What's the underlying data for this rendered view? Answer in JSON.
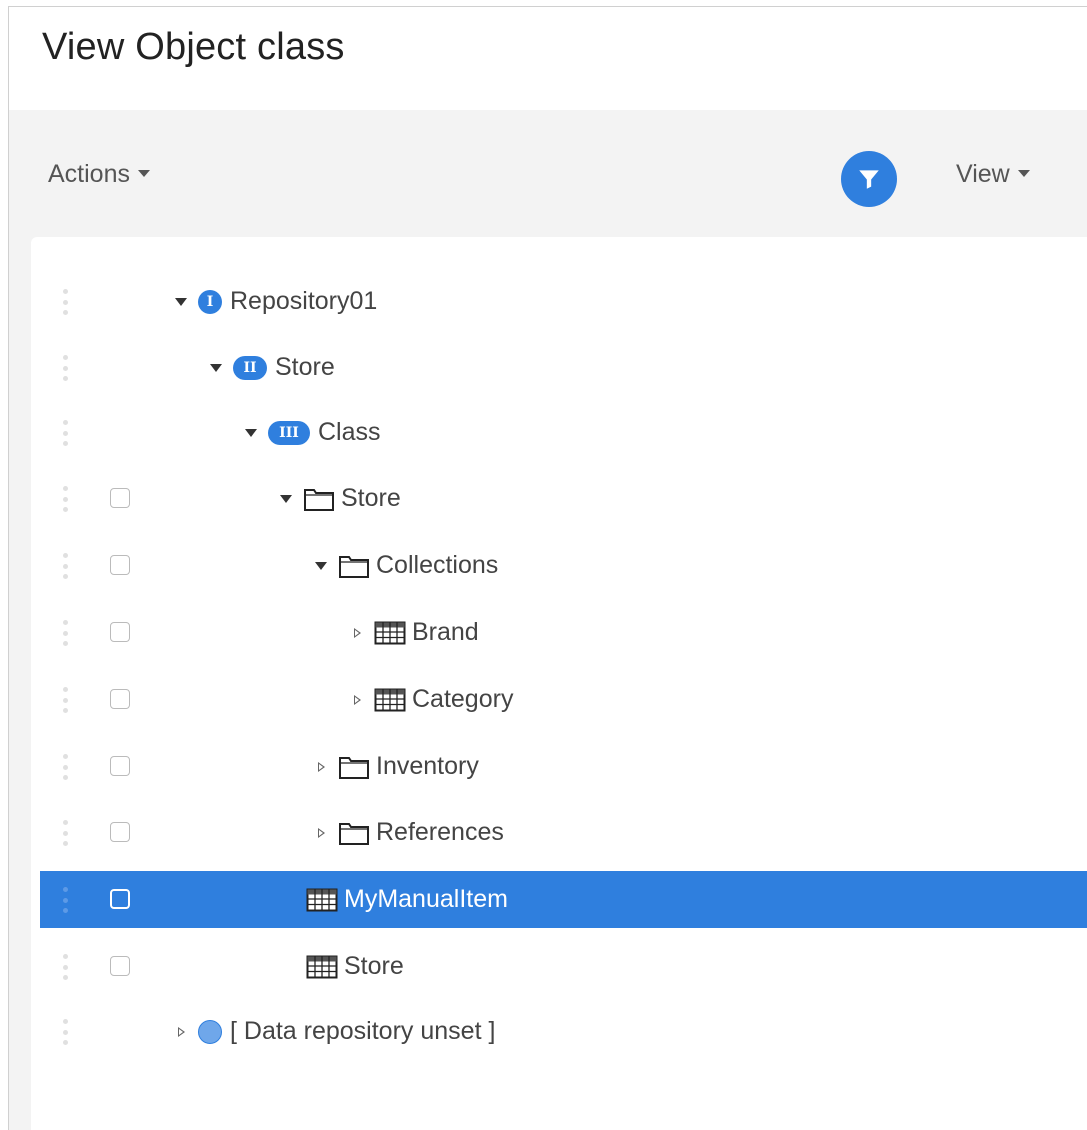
{
  "page": {
    "title": "View Object class"
  },
  "toolbar": {
    "actions_label": "Actions",
    "view_label": "View"
  },
  "tree": {
    "nodes": [
      {
        "label": "Repository01",
        "icon": "level-1-icon",
        "badge": "I",
        "expanded": true,
        "checkbox": false,
        "selected": false
      },
      {
        "label": "Store",
        "icon": "level-2-icon",
        "badge": "II",
        "expanded": true,
        "checkbox": false,
        "selected": false
      },
      {
        "label": "Class",
        "icon": "level-3-icon",
        "badge": "III",
        "expanded": true,
        "checkbox": false,
        "selected": false
      },
      {
        "label": "Store",
        "icon": "folder-icon",
        "expanded": true,
        "checkbox": true,
        "selected": false
      },
      {
        "label": "Collections",
        "icon": "folder-icon",
        "expanded": true,
        "checkbox": true,
        "selected": false
      },
      {
        "label": "Brand",
        "icon": "table-icon",
        "expanded": false,
        "checkbox": true,
        "selected": false
      },
      {
        "label": "Category",
        "icon": "table-icon",
        "expanded": false,
        "checkbox": true,
        "selected": false
      },
      {
        "label": "Inventory",
        "icon": "folder-icon",
        "expanded": false,
        "checkbox": true,
        "selected": false
      },
      {
        "label": "References",
        "icon": "folder-icon",
        "expanded": false,
        "checkbox": true,
        "selected": false
      },
      {
        "label": "MyManualItem",
        "icon": "table-icon",
        "expanded": null,
        "checkbox": true,
        "selected": true
      },
      {
        "label": "Store",
        "icon": "table-icon",
        "expanded": null,
        "checkbox": true,
        "selected": false
      },
      {
        "label": "[ Data repository unset ]",
        "icon": "repository-circle-icon",
        "expanded": false,
        "checkbox": false,
        "selected": false
      }
    ]
  },
  "colors": {
    "accent": "#2f7fde",
    "toolbar_bg": "#f3f3f3",
    "text": "#444444"
  }
}
